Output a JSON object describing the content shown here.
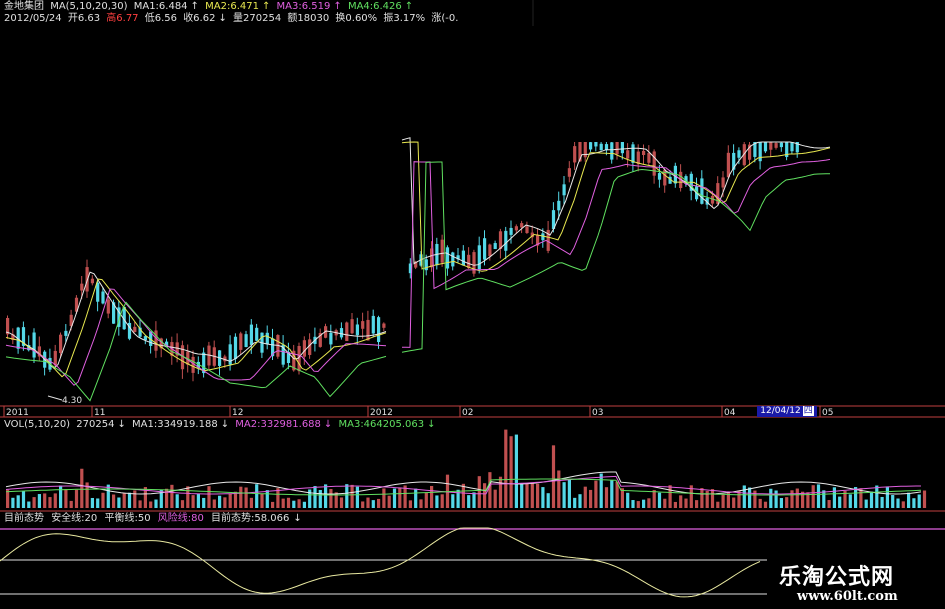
{
  "header": {
    "stock_name": "金地集团",
    "ma_label": "MA(5,10,20,30)",
    "ma1": "MA1:6.484",
    "ma2": "MA2:6.471",
    "ma3": "MA3:6.519",
    "ma4": "MA4:6.426",
    "date": "2012/05/24",
    "open": "开6.63",
    "high": "高6.77",
    "low": "低6.56",
    "close": "收6.62",
    "volume": "量270254",
    "amount": "额18030",
    "turnover": "换0.60%",
    "amplitude": "振3.17%",
    "change": "涨(-0.",
    "arrow_up": "↑",
    "arrow_down": "↓"
  },
  "price_chart": {
    "min_label": "4.30"
  },
  "x_axis": {
    "labels": [
      "2011",
      "11",
      "12",
      "2012",
      "02",
      "03",
      "04",
      "05"
    ]
  },
  "cursor": {
    "date": "12/04/12",
    "weekday": "四"
  },
  "volume_panel": {
    "label": "VOL(5,10,20)",
    "value": "270254",
    "ma1": "MA1:334919.188",
    "ma2": "MA2:332981.688",
    "ma3": "MA3:464205.063"
  },
  "indicator_panel": {
    "name": "目前态势",
    "safe_line": "安全线:20",
    "balance_line": "平衡线:50",
    "risk_line": "风险线:80",
    "current": "目前态势:58.066"
  },
  "watermark": {
    "title": "乐淘公式网",
    "url": "www.60lt.com"
  },
  "colors": {
    "up_candle": "#c05050",
    "down_candle": "#54d8e8",
    "white_text": "#e0e0e0",
    "yellow": "#e8e850",
    "magenta": "#e060e0",
    "green": "#60e060",
    "red": "#ff4040",
    "cyan": "#54d8e8"
  }
}
